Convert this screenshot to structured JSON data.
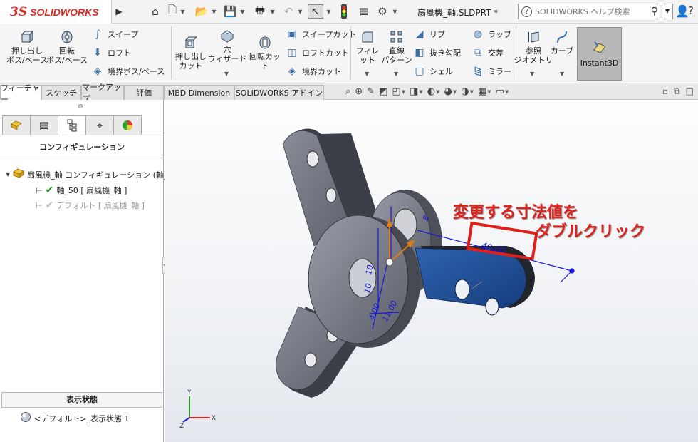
{
  "app": {
    "brand_ds": "3S",
    "brand_name": "SOLIDWORKS",
    "filename": "扇風機_軸.SLDPRT *"
  },
  "quick_access": [
    "home-icon",
    "new-file-icon",
    "open-file-icon",
    "save-icon",
    "print-icon",
    "undo-icon",
    "select-icon",
    "traffic-light-icon",
    "file-properties-icon",
    "options-icon"
  ],
  "help": {
    "placeholder": "SOLIDWORKS ヘルプ検索",
    "q_mark": "?"
  },
  "ribbon": {
    "extrude_boss": "押し出し\nボス/ベース",
    "revolve_boss": "回転\nボス/ベース",
    "sweep": "スイープ",
    "loft": "ロフト",
    "boundary_boss": "境界ボス/ベース",
    "extrude_cut": "押し出し\nカット",
    "hole_wizard": "穴\nウィザード",
    "revolve_cut": "回転カット",
    "sweep_cut": "スイープカット",
    "loft_cut": "ロフトカット",
    "boundary_cut": "境界カット",
    "fillet": "フィレット",
    "linear_pattern": "直線\nパターン",
    "rib": "リブ",
    "draft": "抜き勾配",
    "shell": "シェル",
    "wrap": "ラップ",
    "intersect": "交差",
    "mirror": "ミラー",
    "reference_geometry": "参照\nジオメトリ",
    "curves": "カーブ",
    "instant3d": "Instant3D"
  },
  "tabs": [
    {
      "label": "フィーチャー",
      "active": true
    },
    {
      "label": "スケッチ",
      "active": false
    },
    {
      "label": "マークアップ",
      "active": false
    },
    {
      "label": "評価",
      "active": false
    },
    {
      "label": "MBD Dimension",
      "active": false
    },
    {
      "label": "SOLIDWORKS アドイン",
      "active": false
    }
  ],
  "left_panel": {
    "title": "コンフィギュレーション",
    "root": "扇風機_軸 コンフィギュレーション (軸_50)",
    "config_active": "軸_50 [ 扇風機_軸 ]",
    "config_default": "デフォルト [ 扇風機_軸 ]",
    "display_states_header": "表示状態",
    "display_state": "<デフォルト>_表示状態 1"
  },
  "viewport": {
    "dim_main": "40.00",
    "dim_a": "11.00",
    "dim_b": "4.00",
    "dim_c": "10",
    "dim_d": "8",
    "dim_e": "10",
    "axis_x": "X",
    "axis_y": "Y",
    "axis_z": "Z",
    "annotation_line1": "変更する寸法値を",
    "annotation_line2": "ダブルクリック"
  },
  "colors": {
    "accent_red": "#e0201b",
    "selected_face": "#1f4f97",
    "part_gray": "#6c6f7a",
    "dimension_blue": "#1a1ad8"
  }
}
